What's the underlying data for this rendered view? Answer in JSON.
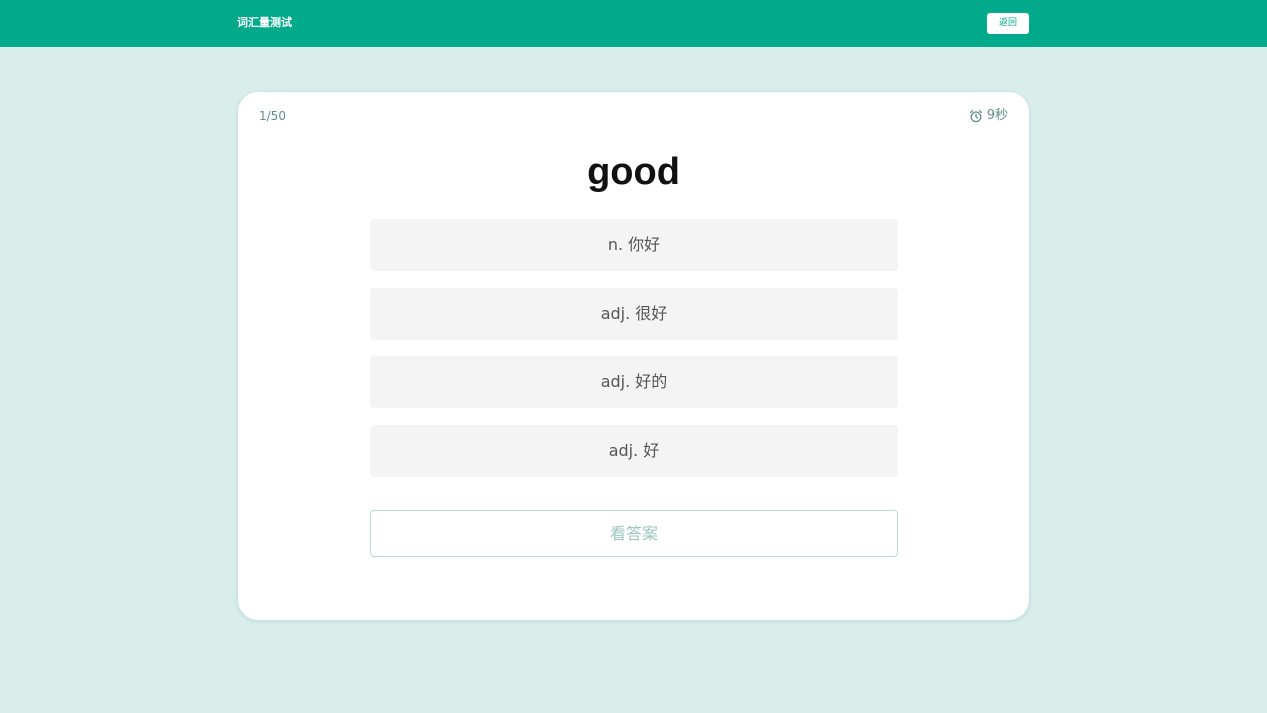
{
  "header": {
    "title": "词汇量测试",
    "back_label": "返回"
  },
  "quiz": {
    "progress": "1/50",
    "timer": "9秒",
    "timer_icon": "alarm-clock-icon",
    "word": "good",
    "options": [
      {
        "label": "n. 你好"
      },
      {
        "label": "adj. 很好"
      },
      {
        "label": "adj. 好的"
      },
      {
        "label": "adj. 好"
      }
    ],
    "show_answer_label": "看答案"
  },
  "colors": {
    "brand": "#02a98a",
    "background": "#d9edeb",
    "option_bg": "#f4f4f4",
    "muted_accent": "#5f8f88"
  }
}
